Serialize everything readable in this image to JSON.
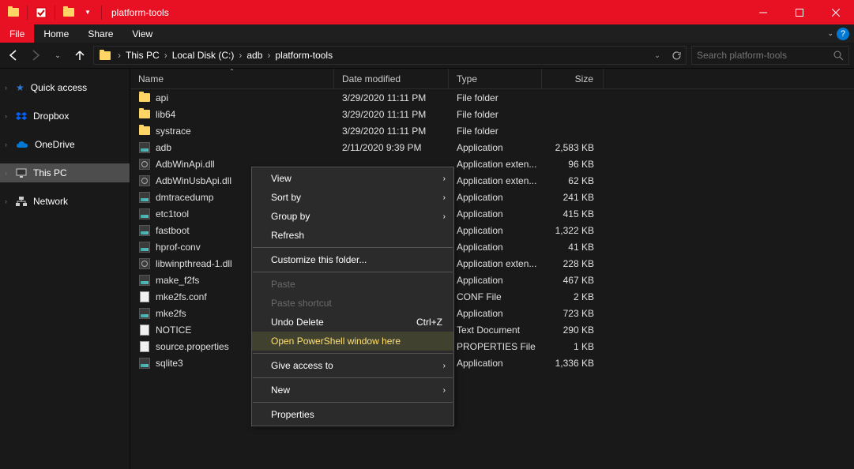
{
  "window": {
    "title": "platform-tools"
  },
  "menubar": {
    "file": "File",
    "home": "Home",
    "share": "Share",
    "view": "View"
  },
  "breadcrumbs": [
    "This PC",
    "Local Disk (C:)",
    "adb",
    "platform-tools"
  ],
  "search": {
    "placeholder": "Search platform-tools"
  },
  "sidebar": {
    "quick_access": "Quick access",
    "dropbox": "Dropbox",
    "onedrive": "OneDrive",
    "this_pc": "This PC",
    "network": "Network"
  },
  "columns": {
    "name": "Name",
    "date": "Date modified",
    "type": "Type",
    "size": "Size"
  },
  "files": [
    {
      "name": "api",
      "date": "3/29/2020 11:11 PM",
      "type": "File folder",
      "size": "",
      "icon": "folder"
    },
    {
      "name": "lib64",
      "date": "3/29/2020 11:11 PM",
      "type": "File folder",
      "size": "",
      "icon": "folder"
    },
    {
      "name": "systrace",
      "date": "3/29/2020 11:11 PM",
      "type": "File folder",
      "size": "",
      "icon": "folder"
    },
    {
      "name": "adb",
      "date": "2/11/2020 9:39 PM",
      "type": "Application",
      "size": "2,583 KB",
      "icon": "exe"
    },
    {
      "name": "AdbWinApi.dll",
      "date": "",
      "type": "Application exten...",
      "size": "96 KB",
      "icon": "dll"
    },
    {
      "name": "AdbWinUsbApi.dll",
      "date": "",
      "type": "Application exten...",
      "size": "62 KB",
      "icon": "dll"
    },
    {
      "name": "dmtracedump",
      "date": "",
      "type": "Application",
      "size": "241 KB",
      "icon": "exe"
    },
    {
      "name": "etc1tool",
      "date": "",
      "type": "Application",
      "size": "415 KB",
      "icon": "exe"
    },
    {
      "name": "fastboot",
      "date": "",
      "type": "Application",
      "size": "1,322 KB",
      "icon": "exe"
    },
    {
      "name": "hprof-conv",
      "date": "",
      "type": "Application",
      "size": "41 KB",
      "icon": "exe"
    },
    {
      "name": "libwinpthread-1.dll",
      "date": "",
      "type": "Application exten...",
      "size": "228 KB",
      "icon": "dll"
    },
    {
      "name": "make_f2fs",
      "date": "",
      "type": "Application",
      "size": "467 KB",
      "icon": "exe"
    },
    {
      "name": "mke2fs.conf",
      "date": "",
      "type": "CONF File",
      "size": "2 KB",
      "icon": "conf"
    },
    {
      "name": "mke2fs",
      "date": "",
      "type": "Application",
      "size": "723 KB",
      "icon": "exe"
    },
    {
      "name": "NOTICE",
      "date": "",
      "type": "Text Document",
      "size": "290 KB",
      "icon": "txt"
    },
    {
      "name": "source.properties",
      "date": "",
      "type": "PROPERTIES File",
      "size": "1 KB",
      "icon": "txt"
    },
    {
      "name": "sqlite3",
      "date": "",
      "type": "Application",
      "size": "1,336 KB",
      "icon": "exe"
    }
  ],
  "context_menu": {
    "view": "View",
    "sort_by": "Sort by",
    "group_by": "Group by",
    "refresh": "Refresh",
    "customize": "Customize this folder...",
    "paste": "Paste",
    "paste_shortcut": "Paste shortcut",
    "undo_delete": "Undo Delete",
    "undo_shortcut": "Ctrl+Z",
    "powershell": "Open PowerShell window here",
    "give_access": "Give access to",
    "new": "New",
    "properties": "Properties"
  }
}
